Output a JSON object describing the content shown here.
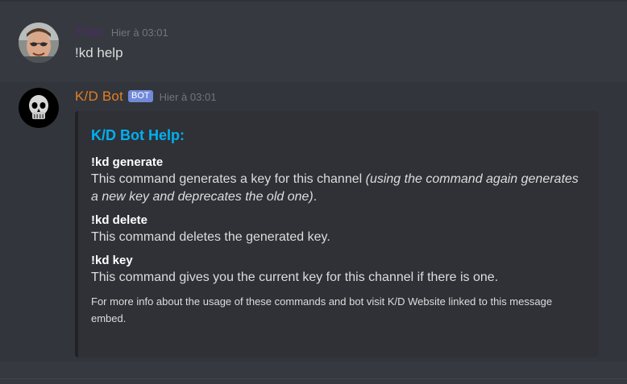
{
  "messages": [
    {
      "username": "Filex",
      "username_color": "#4b2c68",
      "timestamp": "Hier à 03:01",
      "content": "!kd help",
      "avatar_icon": "user-photo-avatar"
    },
    {
      "username": "K/D Bot",
      "username_color": "#e67e22",
      "bot_tag": "BOT",
      "timestamp": "Hier à 03:01",
      "avatar_icon": "skull-avatar",
      "embed": {
        "title": "K/D Bot Help:",
        "title_color": "#00b0f4",
        "fields": [
          {
            "name": "!kd generate",
            "value": "This command generates a key for this channel",
            "value_italic": "(using the command again generates a new key and deprecates the old one)",
            "value_end": "."
          },
          {
            "name": "!kd delete",
            "value": "This command deletes the generated key."
          },
          {
            "name": "!kd key",
            "value": "This command gives you the current key for this channel if there is one."
          }
        ],
        "footer": "For more info about the usage of these commands and bot visit K/D Website linked to this message embed."
      }
    }
  ],
  "colors": {
    "background": "#36393f",
    "embed_background": "#2f3136",
    "bot_tag": "#7289da",
    "timestamp": "#72767d"
  }
}
